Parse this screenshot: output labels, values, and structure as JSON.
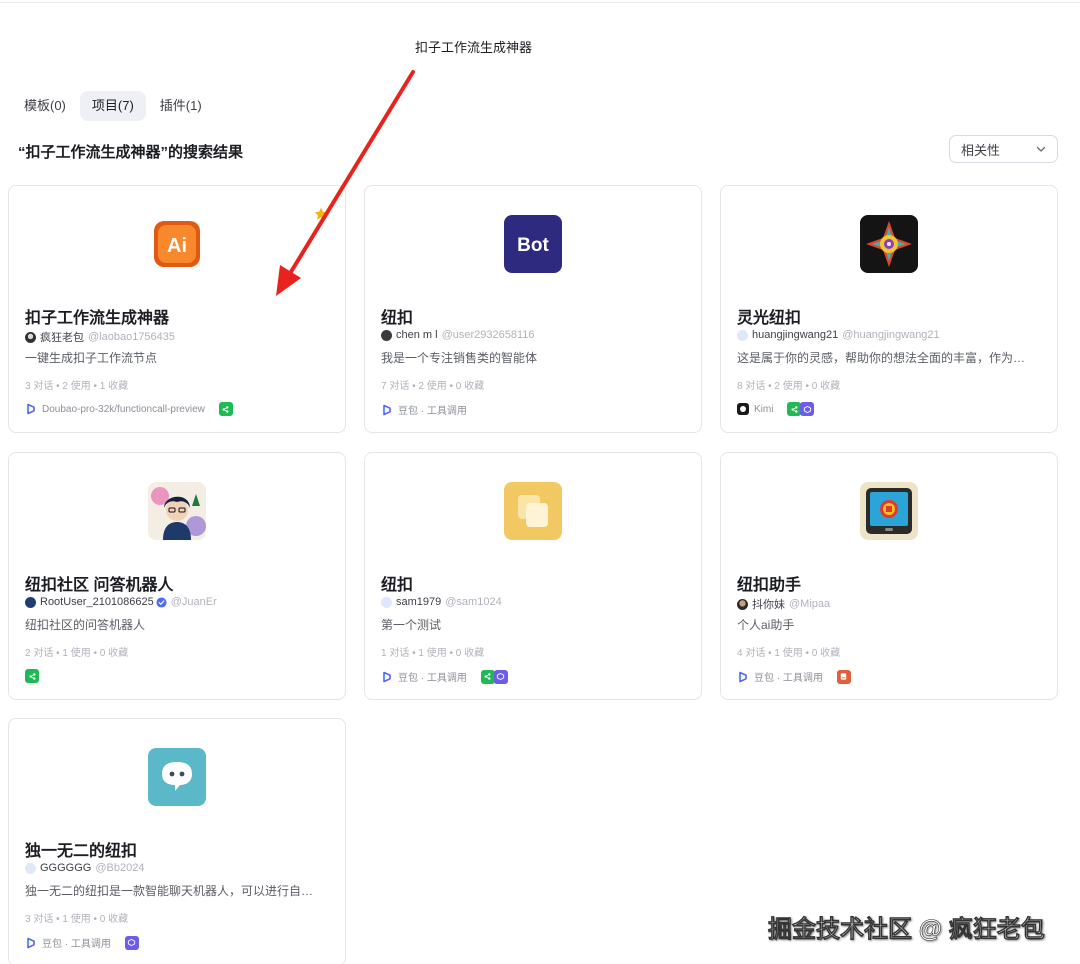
{
  "search": {
    "query": "扣子工作流生成神器"
  },
  "tabs": [
    {
      "label": "模板(0)"
    },
    {
      "label": "项目(7)"
    },
    {
      "label": "插件(1)"
    }
  ],
  "results_title": "“扣子工作流生成神器”的搜索结果",
  "sort": {
    "selected": "相关性"
  },
  "cards": [
    {
      "name": "扣子工作流生成神器",
      "author": "疯狂老包",
      "handle": "@laobao1756435",
      "desc": "一键生成扣子工作流节点",
      "stats": "3 对话 • 2 使用 • 1 收藏",
      "model": "Doubao-pro-32k/functioncall-preview",
      "starred": true
    },
    {
      "name": "纽扣",
      "author": "chen m l",
      "handle": "@user2932658116",
      "desc": "我是一个专注销售类的智能体",
      "stats": "7 对话 • 2 使用 • 0 收藏",
      "model": "豆包 · 工具调用"
    },
    {
      "name": "灵光纽扣",
      "author": "huangjingwang21",
      "handle": "@huangjingwang21",
      "desc": "这是属于你的灵感，帮助你的想法全面的丰富，作为…",
      "stats": "8 对话 • 2 使用 • 0 收藏",
      "model": "Kimi"
    },
    {
      "name": "纽扣社区 问答机器人",
      "author": "RootUser_2101086625",
      "handle": "@JuanEr",
      "desc": "纽扣社区的问答机器人",
      "stats": "2 对话 • 1 使用 • 0 收藏",
      "model": ""
    },
    {
      "name": "纽扣",
      "author": "sam1979",
      "handle": "@sam1024",
      "desc": "第一个测试",
      "stats": "1 对话 • 1 使用 • 0 收藏",
      "model": "豆包 · 工具调用"
    },
    {
      "name": "纽扣助手",
      "author": "抖你妹",
      "handle": "@Mipaa",
      "desc": "个人ai助手",
      "stats": "4 对话 • 1 使用 • 0 收藏",
      "model": "豆包 · 工具调用"
    },
    {
      "name": "独一无二的纽扣",
      "author": "GGGGGG",
      "handle": "@Bb2024",
      "desc": "独一无二的纽扣是一款智能聊天机器人，可以进行自…",
      "stats": "3 对话 • 1 使用 • 0 收藏",
      "model": "豆包 · 工具调用"
    }
  ],
  "avatars": {
    "card1": "Ai",
    "card2": "Bot"
  },
  "watermark": "掘金技术社区 @ 疯狂老包",
  "colors": {
    "accent_arrow": "#e8231d",
    "active_tab_bg": "#eef0f6",
    "wechat_green": "#1fb955"
  }
}
